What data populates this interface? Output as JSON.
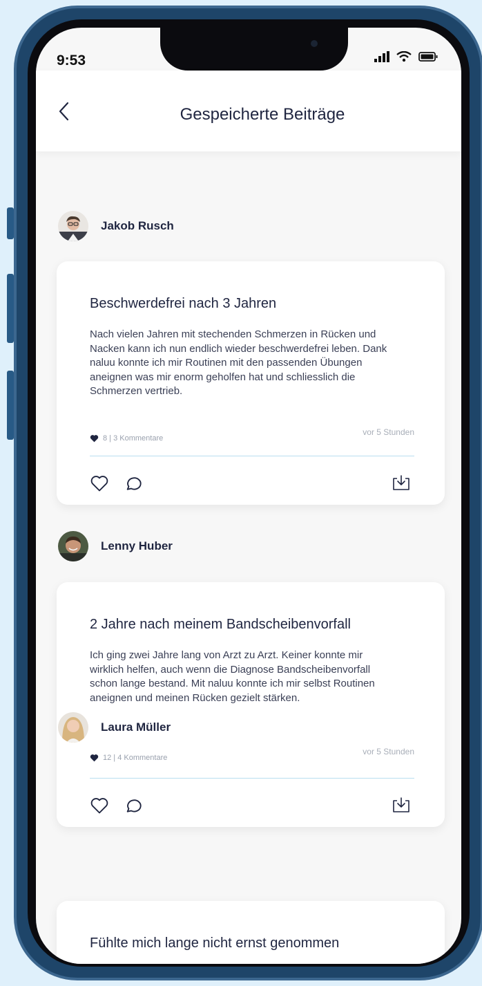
{
  "status_bar": {
    "time": "9:53"
  },
  "header": {
    "title": "Gespeicherte Beiträge"
  },
  "posts": [
    {
      "author": "Jakob Rusch",
      "title": "Beschwerdefrei nach 3 Jahren",
      "body": "Nach vielen Jahren mit stechenden Schmerzen in Rücken und Nacken kann ich nun endlich wieder beschwerdefrei leben. Dank naluu konnte ich mir Routinen mit den passenden Übungen aneignen was mir enorm geholfen hat und schliesslich die Schmerzen vertrieb.",
      "meta": "8 | 3 Kommentare",
      "time": "vor 5 Stunden"
    },
    {
      "author": "Lenny Huber",
      "title": "2 Jahre nach meinem Bandscheibenvorfall",
      "body": "Ich ging zwei Jahre lang von Arzt zu Arzt. Keiner konnte mir wirklich helfen, auch wenn die Diagnose Bandscheibenvorfall schon lange bestand. Mit naluu konnte ich mir selbst Routinen aneignen und meinen Rücken gezielt stärken.",
      "meta": "12 | 4 Kommentare",
      "time": "vor 5 Stunden"
    },
    {
      "author": "Laura Müller",
      "title": "Fühlte mich lange nicht ernst genommen"
    }
  ],
  "icons": {
    "back": "chevron-left-icon",
    "like": "heart-outline-icon",
    "comment": "speech-bubble-icon",
    "save": "tray-download-icon",
    "meta_heart": "heart-filled-icon",
    "signal": "cellular-signal-icon",
    "wifi": "wifi-icon",
    "battery": "battery-icon"
  },
  "colors": {
    "background": "#dff0fb",
    "phone_frame": "#1e4569",
    "text_dark": "#1f2540",
    "divider": "#b9def0"
  }
}
